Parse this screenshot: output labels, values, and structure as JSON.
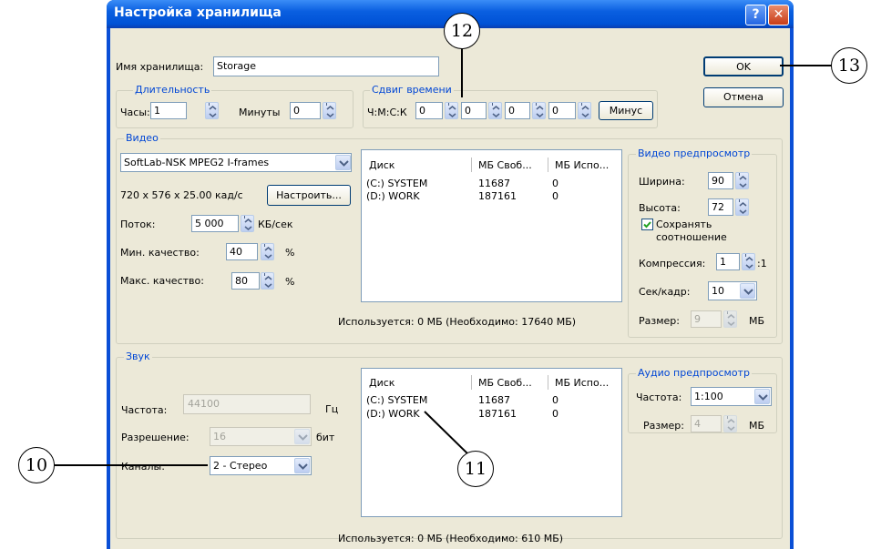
{
  "window": {
    "title": "Настройка хранилища",
    "help_glyph": "?",
    "close_glyph": "✕"
  },
  "storage_name": {
    "label": "Имя хранилища:",
    "value": "Storage"
  },
  "buttons": {
    "ok": "OK",
    "cancel": "Отмена",
    "configure": "Настроить...",
    "minus": "Минус"
  },
  "duration": {
    "group_label": "Длительность",
    "hours_label": "Часы:",
    "hours": "1",
    "minutes_label": "Минуты",
    "minutes": "0"
  },
  "time_shift": {
    "group_label": "Сдвиг времени",
    "format_label": "Ч:М:С:К",
    "values": [
      "0",
      "0",
      "0",
      "0"
    ]
  },
  "video": {
    "group_label": "Видео",
    "codec": "SoftLab-NSK MPEG2 I-frames",
    "format": "720 x 576 x 25.00 кад/с",
    "bitrate_label": "Поток:",
    "bitrate": "5 000",
    "bitrate_unit": "КБ/сек",
    "min_quality_label": "Мин. качество:",
    "min_quality": "40",
    "percent": "%",
    "max_quality_label": "Макс. качество:",
    "max_quality": "80",
    "disks": {
      "columns": [
        "Диск",
        "МБ Своб...",
        "МБ Испо..."
      ],
      "rows": [
        [
          "(C:) SYSTEM",
          "11687",
          "0"
        ],
        [
          "(D:) WORK",
          "187161",
          "0"
        ]
      ]
    },
    "usage": "Используется: 0 МБ (Необходимо: 17640 МБ)"
  },
  "video_preview": {
    "group_label": "Видео предпросмотр",
    "width_label": "Ширина:",
    "width": "90",
    "height_label": "Высота:",
    "height": "72",
    "keep_ratio_line1": "Сохранять",
    "keep_ratio_line2": "соотношение",
    "keep_ratio_checked": true,
    "compression_label": "Компрессия:",
    "compression": "1",
    "compression_suffix": ":1",
    "sec_per_frame_label": "Сек/кадр:",
    "sec_per_frame": "10",
    "size_label": "Размер:",
    "size": "9",
    "size_unit": "МБ"
  },
  "audio": {
    "group_label": "Звук",
    "frequency_label": "Частота:",
    "frequency": "44100",
    "frequency_unit": "Гц",
    "resolution_label": "Разрешение:",
    "resolution": "16",
    "resolution_unit": "бит",
    "channels_label": "Каналы:",
    "channels": "2 - Стерео",
    "disks": {
      "columns": [
        "Диск",
        "МБ Своб...",
        "МБ Испо..."
      ],
      "rows": [
        [
          "(C:) SYSTEM",
          "11687",
          "0"
        ],
        [
          "(D:) WORK",
          "187161",
          "0"
        ]
      ]
    },
    "usage": "Используется: 0 МБ (Необходимо: 610 МБ)"
  },
  "audio_preview": {
    "group_label": "Аудио предпросмотр",
    "frequency_label": "Частота:",
    "frequency": "1:100",
    "size_label": "Размер:",
    "size": "4",
    "size_unit": "МБ"
  },
  "callouts": {
    "c10": "10",
    "c11": "11",
    "c12": "12",
    "c13": "13"
  },
  "colors": {
    "titlebar": "#0a5fe0",
    "dialog_bg": "#ece9d8",
    "group_label": "#0046d5"
  }
}
